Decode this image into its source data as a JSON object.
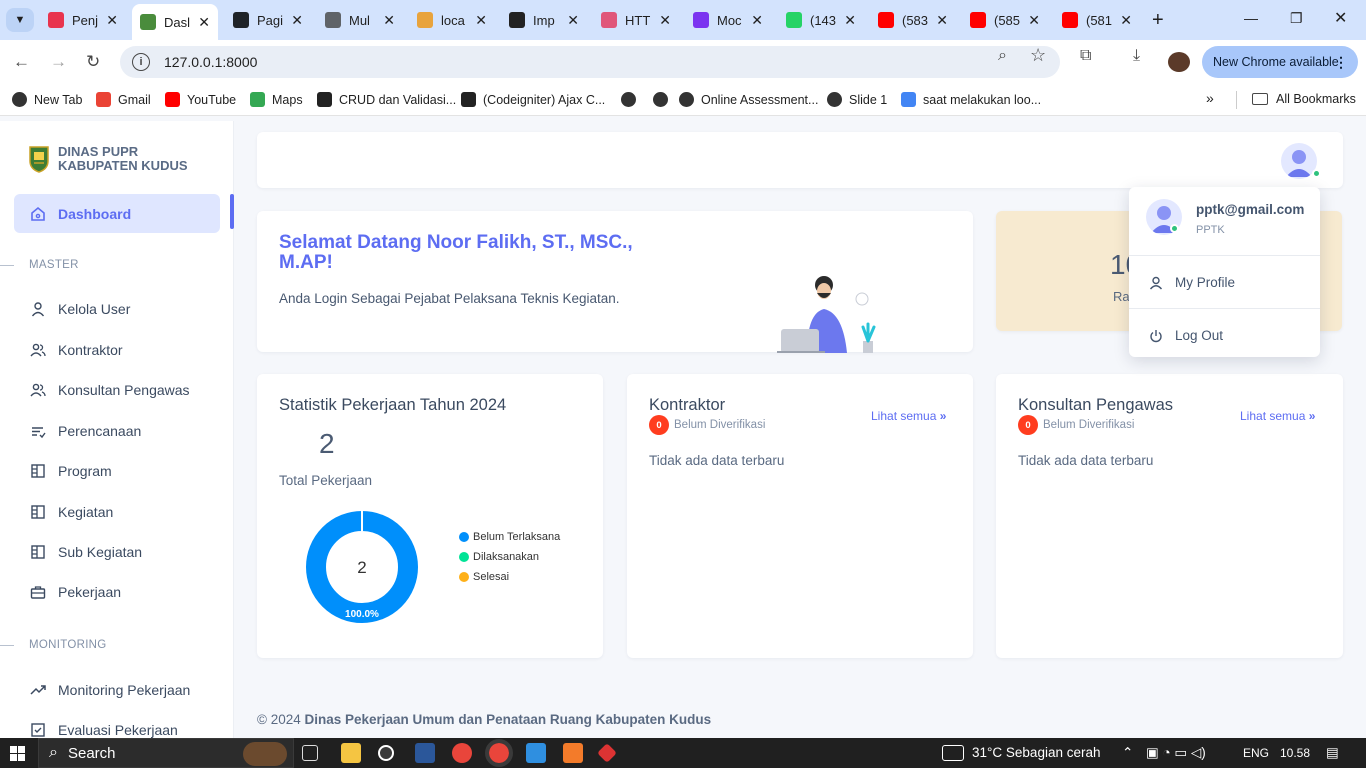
{
  "browser": {
    "tabs": [
      {
        "title": "Penj",
        "color": "#e8344e"
      },
      {
        "title": "Dasl",
        "color": "#4a8c3c",
        "active": true
      },
      {
        "title": "Pagi",
        "color": "#1f2328"
      },
      {
        "title": "Mul",
        "color": "#5f6368"
      },
      {
        "title": "loca",
        "color": "#e8a33c"
      },
      {
        "title": "Imp",
        "color": "#222222"
      },
      {
        "title": "HTT",
        "color": "#e0567a"
      },
      {
        "title": "Moc",
        "color": "#7b34f0"
      },
      {
        "title": "(143",
        "color": "#25d366"
      },
      {
        "title": "(583",
        "color": "#ff0000"
      },
      {
        "title": "(585",
        "color": "#ff0000"
      },
      {
        "title": "(581",
        "color": "#ff0000"
      }
    ],
    "url": "127.0.0.1:8000",
    "update_label": "New Chrome available",
    "bookmarks": [
      {
        "label": "New Tab",
        "icon": "chrome-icon"
      },
      {
        "label": "Gmail",
        "icon": "gmail-icon"
      },
      {
        "label": "YouTube",
        "icon": "youtube-icon"
      },
      {
        "label": "Maps",
        "icon": "maps-icon"
      },
      {
        "label": "CRUD dan Validasi...",
        "icon": "site-icon"
      },
      {
        "label": "(Codeigniter) Ajax C...",
        "icon": "site-icon"
      },
      {
        "label": "Online Assessment...",
        "icon": "globe-icon"
      },
      {
        "label": "Slide 1",
        "icon": "globe-icon"
      },
      {
        "label": "saat melakukan loo...",
        "icon": "google-icon"
      }
    ],
    "all_bookmarks_label": "All Bookmarks"
  },
  "sidebar": {
    "brand_line1": "DINAS PUPR",
    "brand_line2": "KABUPATEN KUDUS",
    "dashboard_label": "Dashboard",
    "section_master": "MASTER",
    "master_items": [
      "Kelola User",
      "Kontraktor",
      "Konsultan Pengawas",
      "Perencanaan",
      "Program",
      "Kegiatan",
      "Sub Kegiatan",
      "Pekerjaan"
    ],
    "section_monitoring": "MONITORING",
    "monitoring_items": [
      "Monitoring Pekerjaan",
      "Evaluasi Pekerjaan"
    ]
  },
  "welcome": {
    "title": "Selamat Datang Noor Falikh, ST., MSC., M.AP!",
    "subtitle": "Anda Login Sebagai Pejabat Pelaksana Teknis Kegiatan."
  },
  "partial_card": {
    "number": "10",
    "label": "Ra"
  },
  "stats": {
    "title": "Statistik Pekerjaan Tahun 2024",
    "total": "2",
    "total_label": "Total Pekerjaan"
  },
  "chart_data": {
    "type": "pie",
    "donut": true,
    "center_label": "2",
    "categories": [
      "Belum Terlaksana",
      "Dilaksanakan",
      "Selesai"
    ],
    "values": [
      2,
      0,
      0
    ],
    "colors": [
      "#008ffb",
      "#00e396",
      "#feb019"
    ],
    "data_labels": [
      "100.0%"
    ],
    "legend_position": "right"
  },
  "kontraktor": {
    "title": "Kontraktor",
    "badge": "0",
    "badge_label": "Belum Diverifikasi",
    "link": "Lihat semua",
    "empty": "Tidak ada data terbaru"
  },
  "konsultan": {
    "title": "Konsultan Pengawas",
    "badge": "0",
    "badge_label": "Belum Diverifikasi",
    "link": "Lihat semua",
    "empty": "Tidak ada data terbaru"
  },
  "user_menu": {
    "email": "pptk@gmail.com",
    "role": "PPTK",
    "profile_label": "My Profile",
    "logout_label": "Log Out"
  },
  "footer": {
    "prefix": "© 2024",
    "org": "Dinas Pekerjaan Umum dan Penataan Ruang Kabupaten Kudus"
  },
  "taskbar": {
    "search_label": "Search",
    "weather": "31°C  Sebagian cerah",
    "lang": "ENG",
    "time": "10.58"
  }
}
